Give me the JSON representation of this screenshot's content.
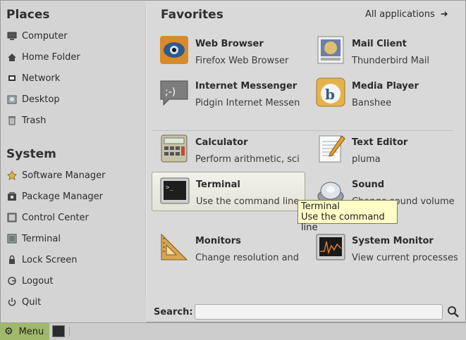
{
  "places": {
    "title": "Places",
    "items": [
      {
        "label": "Computer",
        "icon": "computer-icon"
      },
      {
        "label": "Home Folder",
        "icon": "home-icon"
      },
      {
        "label": "Network",
        "icon": "network-icon"
      },
      {
        "label": "Desktop",
        "icon": "desktop-icon"
      },
      {
        "label": "Trash",
        "icon": "trash-icon"
      }
    ]
  },
  "system": {
    "title": "System",
    "items": [
      {
        "label": "Software Manager",
        "icon": "software-manager-icon"
      },
      {
        "label": "Package Manager",
        "icon": "package-manager-icon"
      },
      {
        "label": "Control Center",
        "icon": "control-center-icon"
      },
      {
        "label": "Terminal",
        "icon": "terminal-icon"
      },
      {
        "label": "Lock Screen",
        "icon": "lock-icon"
      },
      {
        "label": "Logout",
        "icon": "logout-icon"
      },
      {
        "label": "Quit",
        "icon": "power-icon"
      }
    ]
  },
  "favorites": {
    "title": "Favorites",
    "all_apps_label": "All applications",
    "apps": [
      {
        "name": "Web Browser",
        "desc": "Firefox Web Browser",
        "icon": "firefox-icon"
      },
      {
        "name": "Mail Client",
        "desc": "Thunderbird Mail",
        "icon": "thunderbird-icon"
      },
      {
        "name": "Internet Messenger",
        "desc": "Pidgin Internet Messen",
        "icon": "pidgin-icon"
      },
      {
        "name": "Media Player",
        "desc": "Banshee",
        "icon": "banshee-icon"
      },
      {
        "name": "Calculator",
        "desc": "Perform arithmetic, sci",
        "icon": "calculator-icon"
      },
      {
        "name": "Text Editor",
        "desc": "pluma",
        "icon": "text-editor-icon"
      },
      {
        "name": "Terminal",
        "desc": "Use the command line",
        "icon": "terminal-app-icon"
      },
      {
        "name": "Sound",
        "desc": "Change sound volume",
        "icon": "sound-icon"
      },
      {
        "name": "Monitors",
        "desc": "Change resolution and",
        "icon": "monitors-icon"
      },
      {
        "name": "System Monitor",
        "desc": "View current processes",
        "icon": "system-monitor-icon"
      }
    ]
  },
  "tooltip": {
    "title": "Terminal",
    "text": "Use the command line"
  },
  "search": {
    "label": "Search:",
    "value": "",
    "placeholder": ""
  },
  "panel": {
    "menu_label": "Menu"
  },
  "colors": {
    "panel_menu_bg": "#9fb86a",
    "tooltip_bg": "#fffdc7"
  }
}
